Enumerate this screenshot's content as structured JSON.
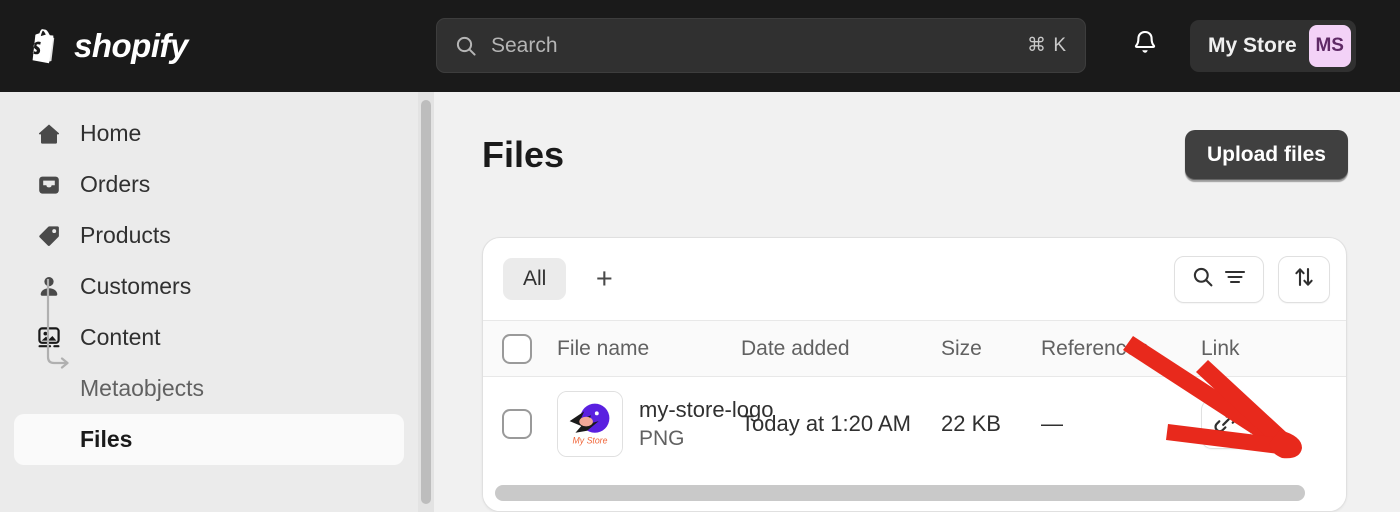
{
  "topbar": {
    "brand_name": "shopify",
    "brand_logo_icon": "shopify-bag-icon",
    "search": {
      "icon": "search-icon",
      "placeholder": "Search",
      "value": "",
      "shortcut": "⌘ K"
    },
    "notifications_icon": "bell-icon",
    "store_name": "My Store",
    "avatar_initials": "MS",
    "avatar_bg": "#f3d2f7",
    "avatar_fg": "#5f2a66",
    "background": "#1a1a1a"
  },
  "sidebar": {
    "background": "#ebebeb",
    "items": [
      {
        "label": "Home",
        "icon": "home-icon",
        "selected": false,
        "sub": false
      },
      {
        "label": "Orders",
        "icon": "orders-icon",
        "selected": false,
        "sub": false
      },
      {
        "label": "Products",
        "icon": "tag-icon",
        "selected": false,
        "sub": false
      },
      {
        "label": "Customers",
        "icon": "person-icon",
        "selected": false,
        "sub": false
      },
      {
        "label": "Content",
        "icon": "content-image-icon",
        "selected": false,
        "sub": false
      }
    ],
    "sub_items": [
      {
        "label": "Metaobjects",
        "selected": false
      },
      {
        "label": "Files",
        "selected": true
      }
    ]
  },
  "main": {
    "background": "#f1f1f1",
    "page_title": "Files",
    "upload_button": "Upload files"
  },
  "card": {
    "tabs": [
      {
        "label": "All",
        "selected": true
      }
    ],
    "add_tab_label": "+",
    "search_filter_icons": [
      "search-icon",
      "filter-icon"
    ],
    "sort_icon": "sort-arrows-icon",
    "table": {
      "columns": [
        "",
        "File name",
        "Date added",
        "Size",
        "References",
        "Link"
      ],
      "rows": [
        {
          "checked": false,
          "thumbnail_icon": "my-store-logo-thumbnail",
          "file_name": "my-store-logo",
          "file_type": "PNG",
          "date_added": "Today at 1:20 AM",
          "size": "22 KB",
          "references": "—",
          "link_icon": "chain-link-icon"
        }
      ]
    },
    "horizontal_scrollbar": true
  },
  "annotation": {
    "type": "arrow",
    "color": "#e8291c",
    "points_to": "chain-link-icon"
  }
}
